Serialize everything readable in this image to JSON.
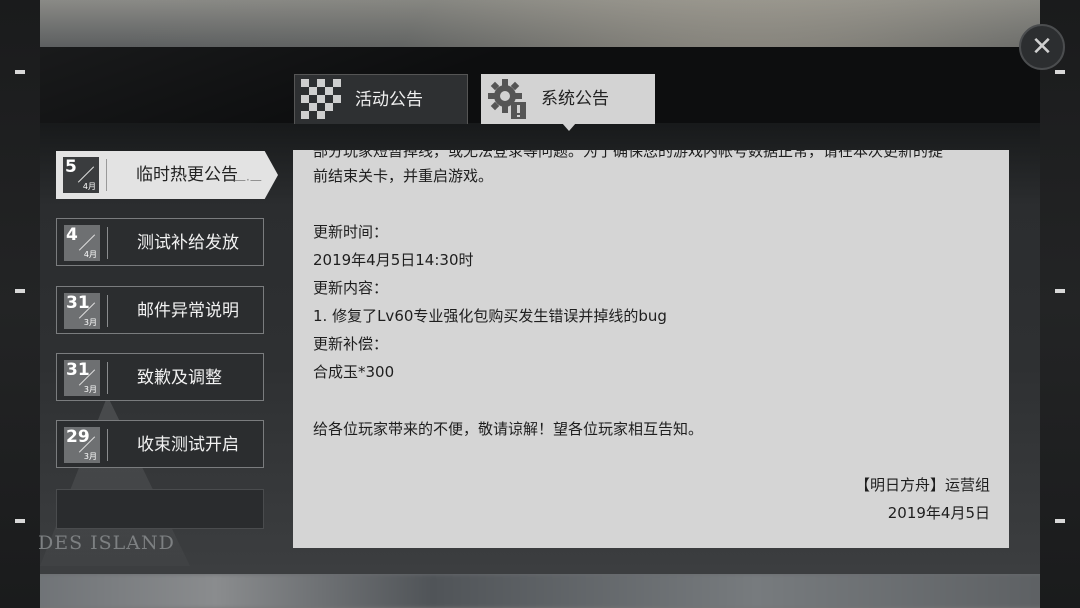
{
  "tabs": [
    {
      "label": "活动公告",
      "icon": "checkered-flag-icon",
      "active": false
    },
    {
      "label": "系统公告",
      "icon": "gear-alert-icon",
      "active": true
    }
  ],
  "notices": [
    {
      "day": "5",
      "month": "4月",
      "title": "临时热更公告",
      "active": true
    },
    {
      "day": "4",
      "month": "4月",
      "title": "测试补给发放",
      "active": false
    },
    {
      "day": "31",
      "month": "3月",
      "title": "邮件异常说明",
      "active": false
    },
    {
      "day": "31",
      "month": "3月",
      "title": "致歉及调整",
      "active": false
    },
    {
      "day": "29",
      "month": "3月",
      "title": "收束测试开启",
      "active": false
    }
  ],
  "content": {
    "clipped_line": "部分玩家短暂掉线，或无法登录等问题。为了确保您的游戏内帐号数据正常，请在本次更新的提",
    "line_1": "前结束关卡，并重启游戏。",
    "update_time_label": "更新时间：",
    "update_time": "2019年4月5日14:30时",
    "update_content_label": "更新内容：",
    "update_content": "1. 修复了Lv60专业强化包购买发生错误并掉线的bug",
    "compensation_label": "更新补偿：",
    "compensation": "合成玉*300",
    "apology": "给各位玩家带来的不便，敬请谅解！望各位玩家相互告知。",
    "signature": "【明日方舟】运营组",
    "date": "2019年4月5日"
  },
  "close_icon": "close-icon",
  "logo_text": "DES ISLAND"
}
